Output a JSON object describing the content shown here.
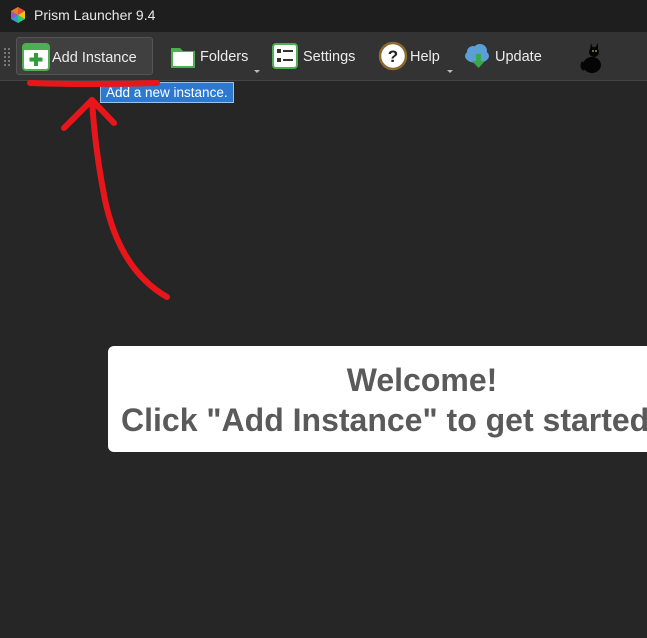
{
  "window": {
    "title": "Prism Launcher 9.4",
    "icon": "prism-logo-icon"
  },
  "toolbar": {
    "buttons": [
      {
        "label": "Add Instance",
        "icon": "add-instance-icon"
      },
      {
        "label": "Folders",
        "icon": "folder-icon"
      },
      {
        "label": "Settings",
        "icon": "settings-icon"
      },
      {
        "label": "Help",
        "icon": "help-icon"
      },
      {
        "label": "Update",
        "icon": "update-cloud-icon"
      }
    ],
    "cat_icon": "black-cat-icon"
  },
  "tooltip": {
    "text": "Add a new instance."
  },
  "welcome": {
    "line1": "Welcome!",
    "line2": "Click \"Add Instance\" to get started"
  },
  "colors": {
    "background": "#262626",
    "toolbar": "#333333",
    "tooltip": "#2d79d0",
    "annotation": "#e8161b"
  }
}
